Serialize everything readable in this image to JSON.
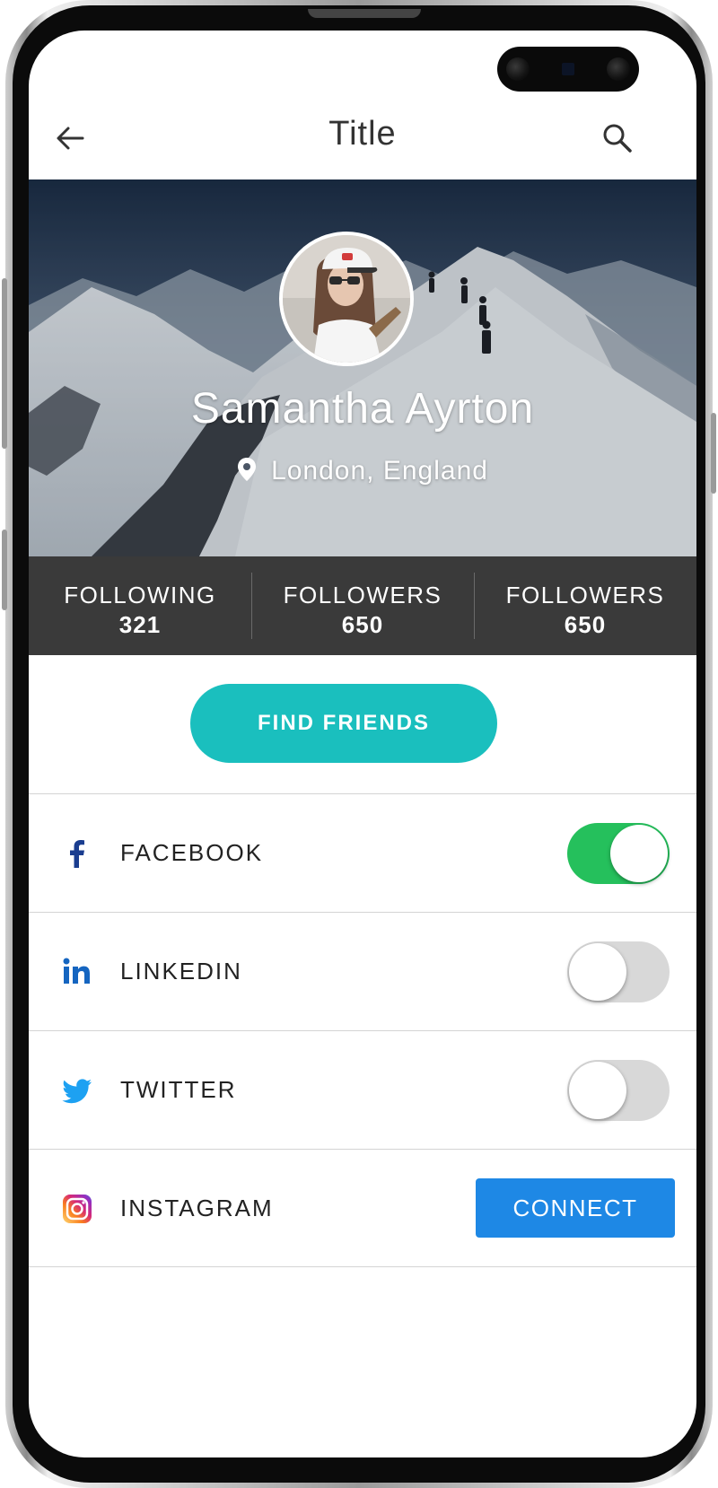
{
  "appbar": {
    "title": "Title",
    "back_icon": "arrow-left-icon",
    "search_icon": "search-icon"
  },
  "profile": {
    "name": "Samantha Ayrton",
    "location": "London, England"
  },
  "stats": [
    {
      "label": "FOLLOWING",
      "value": "321"
    },
    {
      "label": "FOLLOWERS",
      "value": "650"
    },
    {
      "label": "FOLLOWERS",
      "value": "650"
    }
  ],
  "find_friends_label": "FIND FRIENDS",
  "social": [
    {
      "label": "FACEBOOK",
      "icon": "facebook-icon",
      "control": "toggle",
      "enabled": true
    },
    {
      "label": "LINKEDIN",
      "icon": "linkedin-icon",
      "control": "toggle",
      "enabled": false
    },
    {
      "label": "TWITTER",
      "icon": "twitter-icon",
      "control": "toggle",
      "enabled": false
    },
    {
      "label": "INSTAGRAM",
      "icon": "instagram-icon",
      "control": "button",
      "button_label": "CONNECT"
    }
  ],
  "colors": {
    "accent_teal": "#1abfbe",
    "toggle_on": "#25c05c",
    "connect_blue": "#1e88e5",
    "stats_bg": "#3a3a3a"
  }
}
